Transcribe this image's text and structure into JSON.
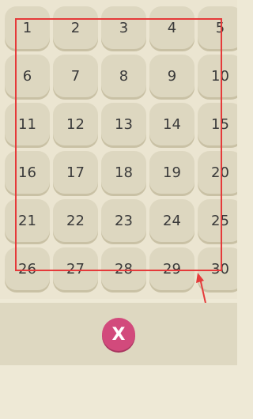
{
  "level_grid": {
    "levels": [
      "1",
      "2",
      "3",
      "4",
      "5",
      "6",
      "7",
      "8",
      "9",
      "10",
      "11",
      "12",
      "13",
      "14",
      "15",
      "16",
      "17",
      "18",
      "19",
      "20",
      "21",
      "22",
      "23",
      "24",
      "25",
      "26",
      "27",
      "28",
      "29",
      "30"
    ]
  },
  "bottom_bar": {
    "close_label": "X"
  },
  "colors": {
    "background": "#eee9d6",
    "cell": "#ddd7c0",
    "highlight": "#e53a3a",
    "close_button": "#d24a7c"
  },
  "icons": {
    "close": "close-icon",
    "arrow": "annotation-arrow-icon"
  }
}
